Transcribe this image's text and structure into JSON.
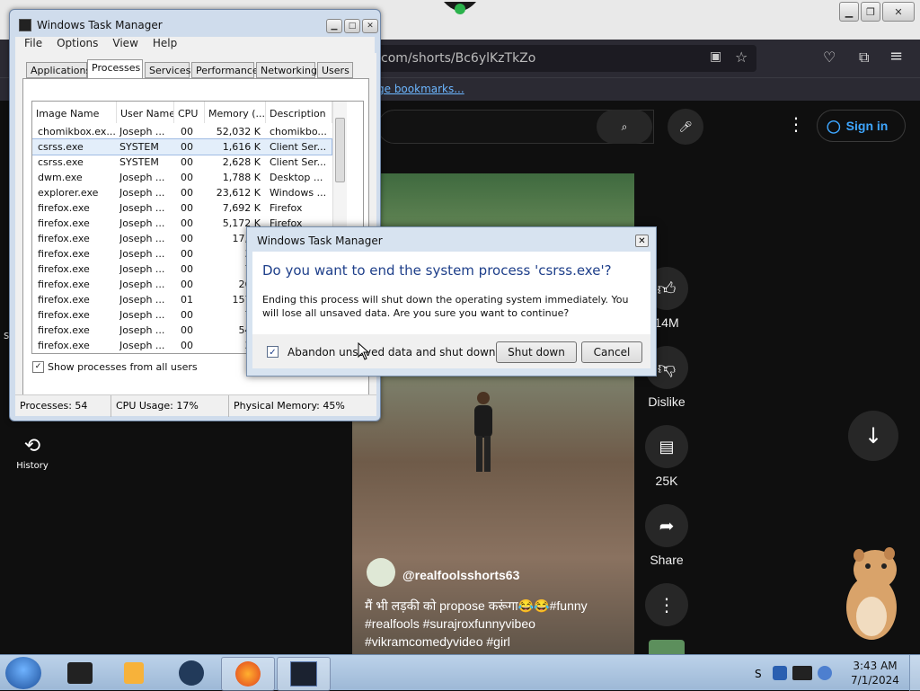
{
  "browser": {
    "url_visible": "com/shorts/Bc6ylKzTkZo",
    "bookmarks_text": "ge bookmarks...",
    "window_controls": [
      "minimize-icon",
      "restore-icon",
      "close-icon"
    ]
  },
  "youtube": {
    "sign_in": "Sign in",
    "history_label": "History",
    "like_count": "14M",
    "dislike_label": "Dislike",
    "comment_count": "25K",
    "share_label": "Share",
    "channel": "@realfoolsshorts63",
    "caption_line1": "मैं भी लड़की को propose करूंगा😂😂#funny",
    "caption_line2": "#realfools #surajroxfunnyvibeo",
    "caption_line3": "#vikramcomedyvideo #girl",
    "left_char": "s"
  },
  "taskmgr": {
    "title": "Windows Task Manager",
    "menu": [
      "File",
      "Options",
      "View",
      "Help"
    ],
    "tabs": [
      "Applications",
      "Processes",
      "Services",
      "Performance",
      "Networking",
      "Users"
    ],
    "active_tab": "Processes",
    "columns": [
      "Image Name",
      "User Name",
      "CPU",
      "Memory (...",
      "Description"
    ],
    "rows": [
      {
        "name": "chomikbox.ex...",
        "user": "Joseph ...",
        "cpu": "00",
        "mem": "52,032 K",
        "desc": "chomikbo..."
      },
      {
        "name": "csrss.exe",
        "user": "SYSTEM",
        "cpu": "00",
        "mem": "1,616 K",
        "desc": "Client Ser..."
      },
      {
        "name": "csrss.exe",
        "user": "SYSTEM",
        "cpu": "00",
        "mem": "2,628 K",
        "desc": "Client Ser..."
      },
      {
        "name": "dwm.exe",
        "user": "Joseph ...",
        "cpu": "00",
        "mem": "1,788 K",
        "desc": "Desktop ..."
      },
      {
        "name": "explorer.exe",
        "user": "Joseph ...",
        "cpu": "00",
        "mem": "23,612 K",
        "desc": "Windows ..."
      },
      {
        "name": "firefox.exe",
        "user": "Joseph ...",
        "cpu": "00",
        "mem": "7,692 K",
        "desc": "Firefox"
      },
      {
        "name": "firefox.exe",
        "user": "Joseph ...",
        "cpu": "00",
        "mem": "5,172 K",
        "desc": "Firefox"
      },
      {
        "name": "firefox.exe",
        "user": "Joseph ...",
        "cpu": "00",
        "mem": "17,76",
        "desc": ""
      },
      {
        "name": "firefox.exe",
        "user": "Joseph ...",
        "cpu": "00",
        "mem": "3,6",
        "desc": ""
      },
      {
        "name": "firefox.exe",
        "user": "Joseph ...",
        "cpu": "00",
        "mem": "7,7",
        "desc": ""
      },
      {
        "name": "firefox.exe",
        "user": "Joseph ...",
        "cpu": "00",
        "mem": "26,7",
        "desc": ""
      },
      {
        "name": "firefox.exe",
        "user": "Joseph ...",
        "cpu": "01",
        "mem": "157,2",
        "desc": ""
      },
      {
        "name": "firefox.exe",
        "user": "Joseph ...",
        "cpu": "00",
        "mem": "7,7",
        "desc": ""
      },
      {
        "name": "firefox.exe",
        "user": "Joseph ...",
        "cpu": "00",
        "mem": "54,2",
        "desc": ""
      },
      {
        "name": "firefox.exe",
        "user": "Joseph ...",
        "cpu": "00",
        "mem": "3,7",
        "desc": ""
      }
    ],
    "selected_row": 1,
    "show_all": "Show processes from all users",
    "status_processes": "Processes: 54",
    "status_cpu": "CPU Usage: 17%",
    "status_mem": "Physical Memory: 45%"
  },
  "dialog": {
    "title": "Windows Task Manager",
    "heading": "Do you want to end the system process 'csrss.exe'?",
    "body": "Ending this process will shut down the operating system immediately.  You will lose all unsaved data.  Are you sure you want to continue?",
    "checkbox": "Abandon unsaved data and shut down.",
    "shutdown_btn": "Shut down",
    "cancel_btn": "Cancel"
  },
  "taskbar": {
    "time": "3:43 AM",
    "date": "7/1/2024",
    "tray_char": "S"
  }
}
